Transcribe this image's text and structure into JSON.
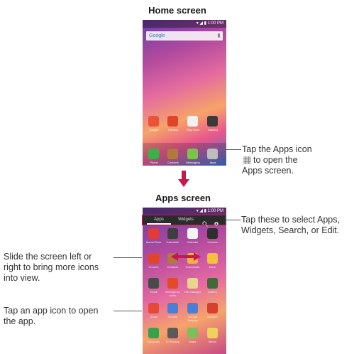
{
  "home": {
    "title": "Home screen",
    "status": "▾ ◢ ▮ 1:00 PM",
    "search_label": "Google",
    "row1": [
      {
        "label": "Google",
        "icon": "google-folder-icon",
        "color": "#e8533a"
      },
      {
        "label": "Chrome",
        "icon": "chrome-icon",
        "color": "#e0452c"
      },
      {
        "label": "Play Store",
        "icon": "play-store-icon",
        "color": "#f2f2f2"
      },
      {
        "label": "Camera",
        "icon": "camera-icon",
        "color": "#3a3a3a"
      }
    ],
    "dock": [
      {
        "label": "Phone",
        "icon": "phone-icon",
        "color": "#3fae4a"
      },
      {
        "label": "Contacts",
        "icon": "contacts-icon",
        "color": "#b0793f"
      },
      {
        "label": "Messaging",
        "icon": "messaging-icon",
        "color": "#7cc34a"
      },
      {
        "label": "Apps",
        "icon": "apps-grid-icon",
        "color": "#bdbdbd"
      }
    ]
  },
  "home_callout": {
    "line1": "Tap the Apps icon",
    "line2": "to open the",
    "line3": "Apps screen."
  },
  "apps": {
    "title": "Apps screen",
    "status": "▾ ◢ ▮ 1:00 PM",
    "tabs": [
      "Apps",
      "Widgets"
    ],
    "grid": [
      {
        "label": "Alarm/Clock",
        "color": "#e23b3b"
      },
      {
        "label": "Calculator",
        "color": "#3e3e3e"
      },
      {
        "label": "Calendar",
        "color": "#f4f4f4"
      },
      {
        "label": "Camera",
        "color": "#2e2e2e"
      },
      {
        "label": "Chrome",
        "color": "#e0452c"
      },
      {
        "label": "Contacts",
        "color": "#b0793f"
      },
      {
        "label": "Downloads",
        "color": "#f0b43a"
      },
      {
        "label": "Drive",
        "color": "#f3c13a"
      },
      {
        "label": "Email",
        "color": "#4a4a4a"
      },
      {
        "label": "Emergency alerts",
        "color": "#e24a2a"
      },
      {
        "label": "File Manager",
        "color": "#e8d690"
      },
      {
        "label": "Gallery",
        "color": "#3f6b3a"
      },
      {
        "label": "Gmail",
        "color": "#e44a3a"
      },
      {
        "label": "Google",
        "color": "#4a7fd6"
      },
      {
        "label": "Google Settings",
        "color": "#4a7fd6"
      },
      {
        "label": "Google+",
        "color": "#d6402e"
      },
      {
        "label": "Hangouts",
        "color": "#3aa04a"
      },
      {
        "label": "LG Backup",
        "color": "#5a5a5a"
      },
      {
        "label": "Maps",
        "color": "#7bbf5a"
      },
      {
        "label": "Memo",
        "color": "#f1d15a"
      }
    ]
  },
  "apps_callouts": {
    "tabs_line1": "Tap these to select Apps,",
    "tabs_line2": "Widgets, Search, or Edit.",
    "slide_line1": "Slide the screen left or",
    "slide_line2": "right to bring more icons",
    "slide_line3": "into view.",
    "tap_line1": "Tap an app icon to open",
    "tap_line2": "the app."
  },
  "colors": {
    "accent": "#c8174f",
    "leader": "#555555"
  }
}
